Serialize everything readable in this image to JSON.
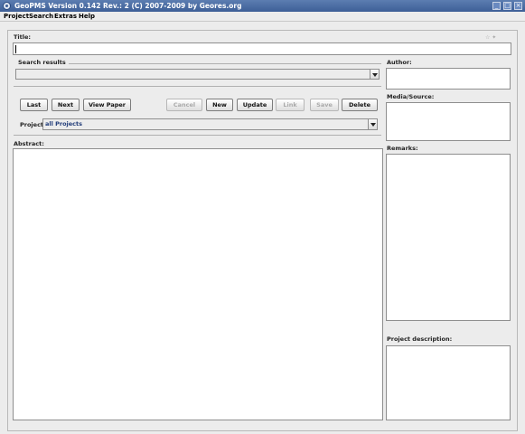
{
  "window": {
    "title": "GeoPMS Version 0.142 Rev.: 2  (C) 2007-2009 by Geores.org",
    "minimize_glyph": "_",
    "maximize_glyph": "□",
    "close_glyph": "×"
  },
  "menu": [
    "Project",
    "Search",
    "Extras",
    "Help"
  ],
  "form": {
    "title_label": "Title:",
    "title_value": "",
    "hint_icons": "☆ ✦",
    "search_results_label": "Search results",
    "search_results_value": "",
    "project_label": "Project:",
    "project_value": "all Projects",
    "abstract_label": "Abstract:",
    "abstract_value": "",
    "author_label": "Author:",
    "author_value": "",
    "media_label": "Media/Source:",
    "media_value": "",
    "remarks_label": "Remarks:",
    "remarks_value": "",
    "project_description_label": "Project description:",
    "project_description_value": ""
  },
  "buttons": {
    "last": "Last",
    "next": "Next",
    "view_paper": "View Paper",
    "cancel": "Cancel",
    "new": "New",
    "update": "Update",
    "link": "Link",
    "save": "Save",
    "delete": "Delete"
  },
  "button_states": {
    "cancel_enabled": false,
    "link_enabled": false,
    "save_enabled": false
  }
}
